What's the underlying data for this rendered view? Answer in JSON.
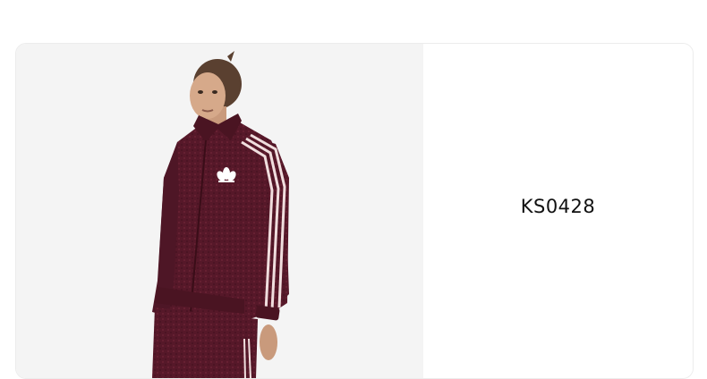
{
  "product": {
    "image": "woman-in-burgundy-adidas-track-jacket",
    "image_background": "#f4f4f4",
    "garment_color": "#5a1a2a",
    "stripe_color": "#f0dede",
    "sku": "KS0428"
  }
}
